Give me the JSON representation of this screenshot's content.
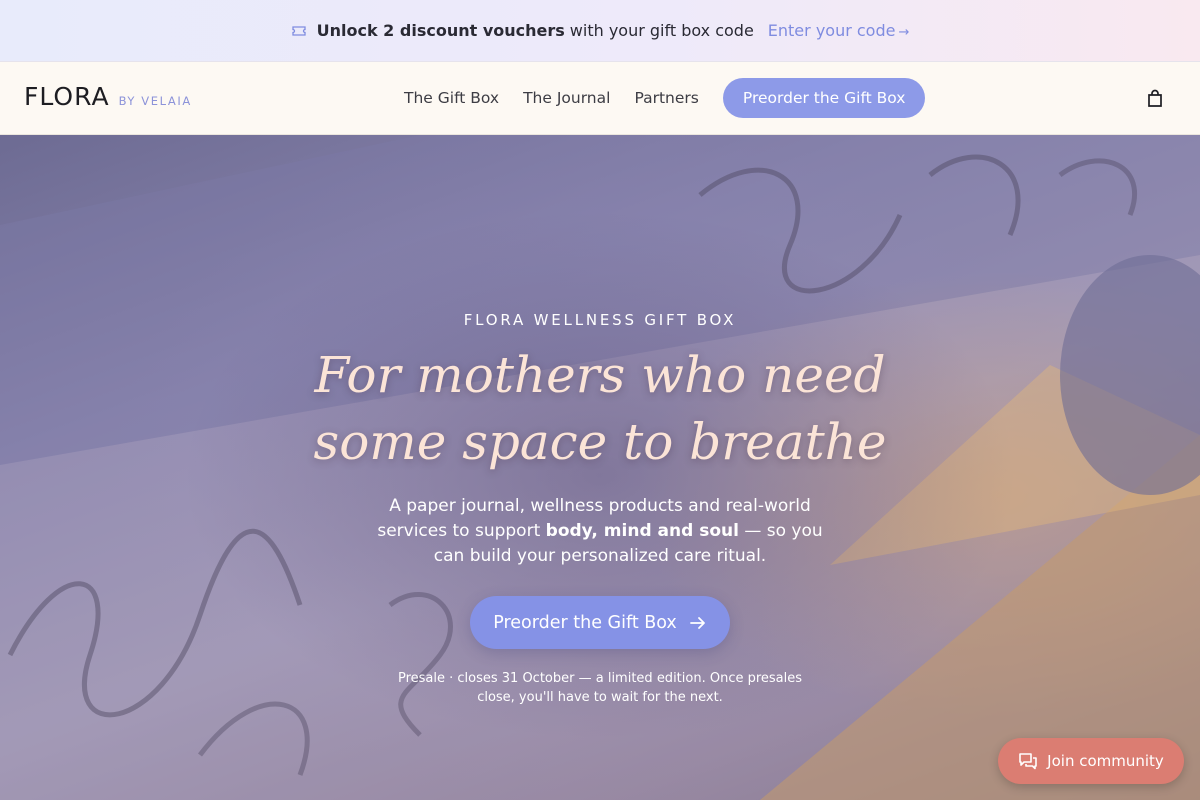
{
  "promo": {
    "bold_text": "Unlock 2 discount vouchers",
    "rest_text": "with your gift box code",
    "link_text": "Enter your code",
    "link_arrow": "→"
  },
  "header": {
    "logo_word": "FLORA",
    "logo_by": "BY VELAIA",
    "nav": [
      "The Gift Box",
      "The Journal",
      "Partners"
    ],
    "cta": "Preorder the Gift Box",
    "cart_icon": "shopping-bag-icon"
  },
  "hero": {
    "eyebrow": "FLORA WELLNESS GIFT BOX",
    "headline": "For mothers who need some space to breathe",
    "sub_before": "A paper journal, wellness products and real-world services to support ",
    "sub_bold": "body, mind and soul",
    "sub_after": " — so you can build your personalized care ritual.",
    "cta": "Preorder the Gift Box",
    "note": "Presale · closes 31 October — a limited edition. Once presales close, you'll have to wait for the next."
  },
  "community": {
    "label": "Join community",
    "icon": "chat-icon"
  },
  "colors": {
    "accent": "#8592e6",
    "coral": "#db7d72",
    "header_bg": "#fdf9f3",
    "headline": "#fbe4d7"
  }
}
